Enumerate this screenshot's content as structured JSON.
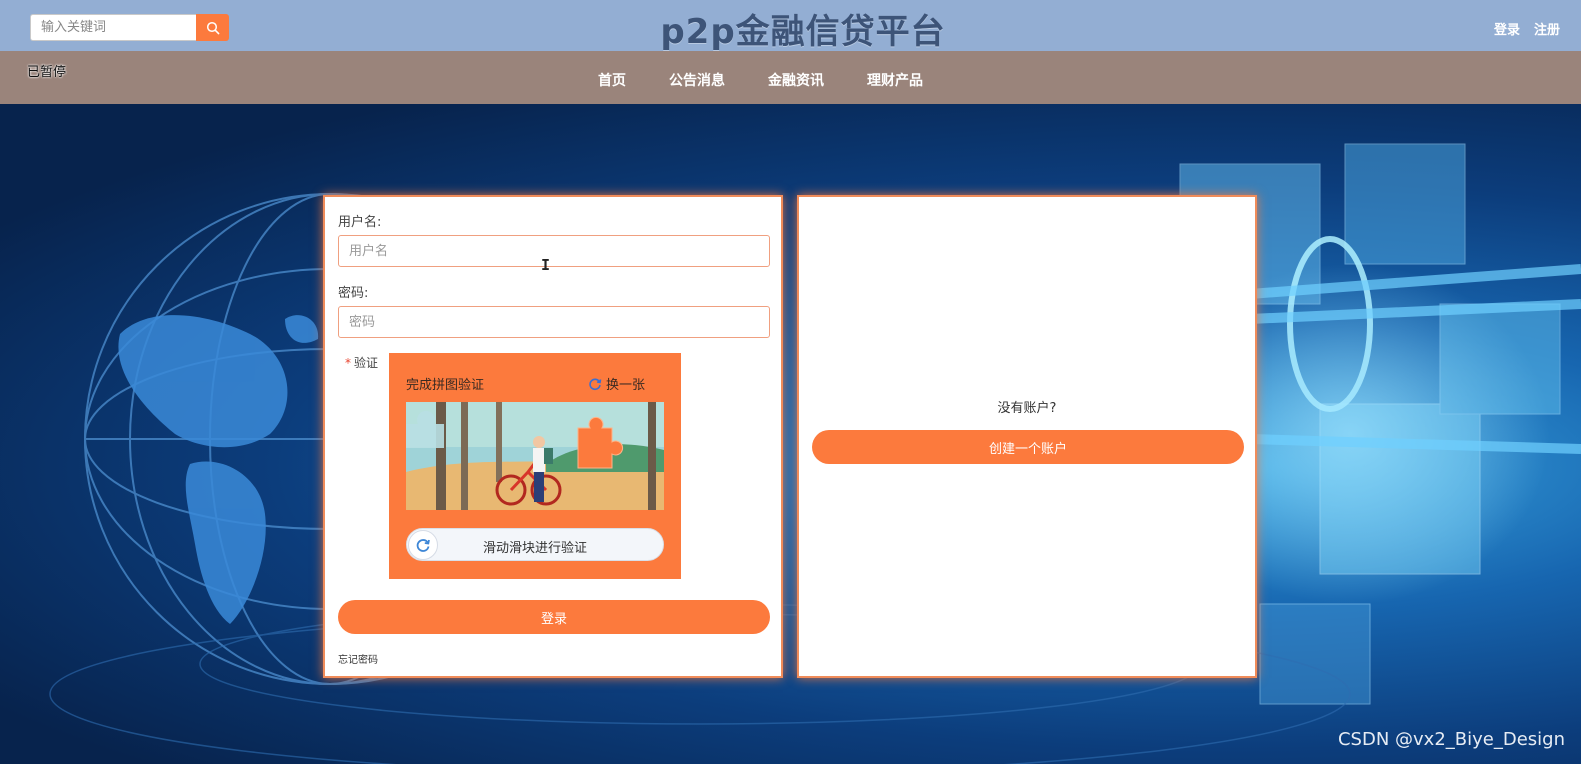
{
  "header": {
    "search_placeholder": "输入关键词",
    "site_title": "p2p金融信贷平台",
    "login_link": "登录",
    "register_link": "注册"
  },
  "nav": {
    "status_text": "已暂停",
    "items": [
      "首页",
      "公告消息",
      "金融资讯",
      "理财产品"
    ]
  },
  "login_form": {
    "username_label": "用户名:",
    "username_placeholder": "用户名",
    "password_label": "密码:",
    "password_placeholder": "密码",
    "verify_label": "验证",
    "captcha_title": "完成拼图验证",
    "captcha_refresh": "换一张",
    "slider_text": "滑动滑块进行验证",
    "submit_label": "登录",
    "forgot_label": "忘记密码"
  },
  "register_panel": {
    "prompt": "没有账户?",
    "create_label": "创建一个账户"
  },
  "watermark": "CSDN @vx2_Biye_Design",
  "colors": {
    "accent": "#fc7a3d",
    "topbar": "#93aed3",
    "navbar": "#9a847b"
  }
}
